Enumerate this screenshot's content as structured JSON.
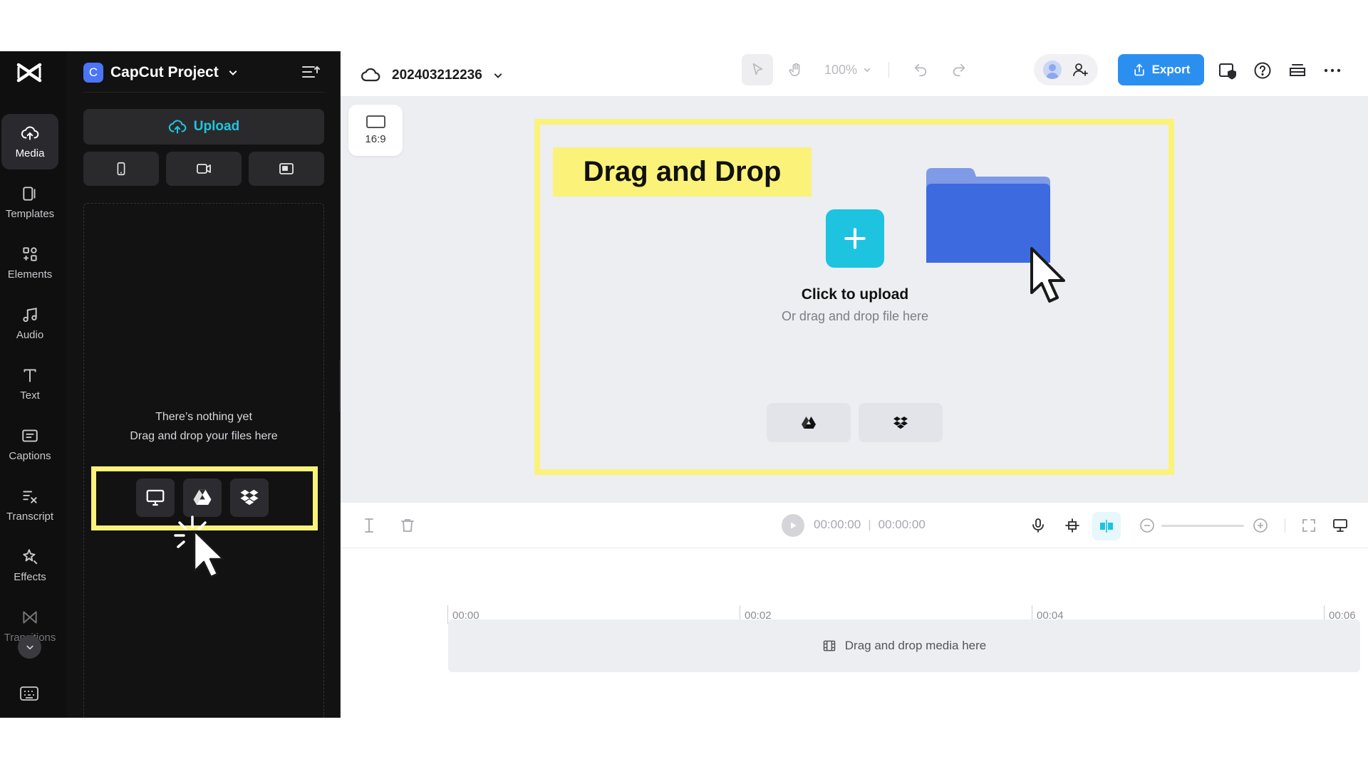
{
  "app": {
    "brand_logo": "capcut-logo"
  },
  "sidebar": {
    "items": [
      {
        "label": "Media",
        "icon": "cloud-upload-icon",
        "active": true
      },
      {
        "label": "Templates",
        "icon": "templates-icon"
      },
      {
        "label": "Elements",
        "icon": "elements-icon"
      },
      {
        "label": "Audio",
        "icon": "music-note-icon"
      },
      {
        "label": "Text",
        "icon": "text-icon"
      },
      {
        "label": "Captions",
        "icon": "captions-icon"
      },
      {
        "label": "Transcript",
        "icon": "transcript-icon"
      },
      {
        "label": "Effects",
        "icon": "effects-icon"
      },
      {
        "label": "Transitions",
        "icon": "transitions-icon"
      }
    ]
  },
  "panel": {
    "project_badge": "C",
    "project_title": "CapCut Project",
    "upload_label": "Upload",
    "empty_line1": "There’s nothing yet",
    "empty_line2": "Drag and drop your files here",
    "source_buttons": [
      "phone-icon",
      "camera-icon",
      "screen-record-icon"
    ],
    "upload_sources": [
      "computer-icon",
      "google-drive-icon",
      "dropbox-icon"
    ]
  },
  "topbar": {
    "project_name": "202403212236",
    "zoom": "100%",
    "export_label": "Export"
  },
  "canvas": {
    "aspect_ratio": "16:9",
    "drag_drop_label": "Drag and Drop",
    "click_to_upload": "Click to upload",
    "or_drag": "Or drag and drop file here"
  },
  "timeline": {
    "current_time": "00:00:00",
    "total_time": "00:00:00",
    "ruler": [
      "00:00",
      "00:02",
      "00:04",
      "00:06"
    ],
    "drop_media": "Drag and drop media here"
  },
  "colors": {
    "accent": "#22c3dc",
    "highlight": "#fbf27a",
    "export": "#2b8ff0",
    "folder": "#3e6ae0"
  }
}
